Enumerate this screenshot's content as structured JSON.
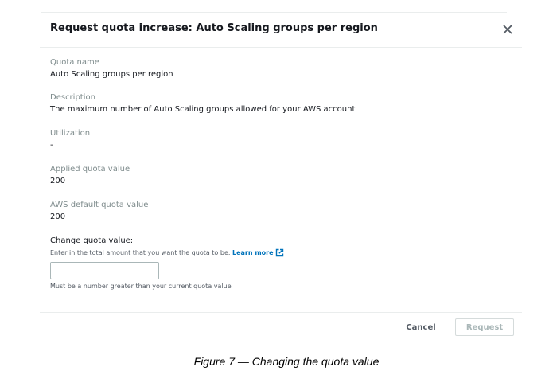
{
  "modal": {
    "title": "Request quota increase: Auto Scaling groups per region",
    "close_icon": "close-icon"
  },
  "fields": {
    "quota_name": {
      "label": "Quota name",
      "value": "Auto Scaling groups per region"
    },
    "description": {
      "label": "Description",
      "value": "The maximum number of Auto Scaling groups allowed for your AWS account"
    },
    "utilization": {
      "label": "Utilization",
      "value": "-"
    },
    "applied_quota": {
      "label": "Applied quota value",
      "value": "200"
    },
    "default_quota": {
      "label": "AWS default quota value",
      "value": "200"
    }
  },
  "change_quota": {
    "label": "Change quota value:",
    "description": "Enter in the total amount that you want the quota to be.",
    "learn_more": "Learn more",
    "learn_more_icon": "external-link-icon",
    "input_value": "",
    "constraint": "Must be a number greater than your current quota value"
  },
  "footer": {
    "cancel_label": "Cancel",
    "request_label": "Request"
  },
  "caption": "Figure 7 — Changing the quota value",
  "colors": {
    "link": "#0073bb",
    "label_gray": "#7f8c8d",
    "text": "#16191f",
    "disabled": "#aab7b8",
    "divider": "#eaeded"
  }
}
